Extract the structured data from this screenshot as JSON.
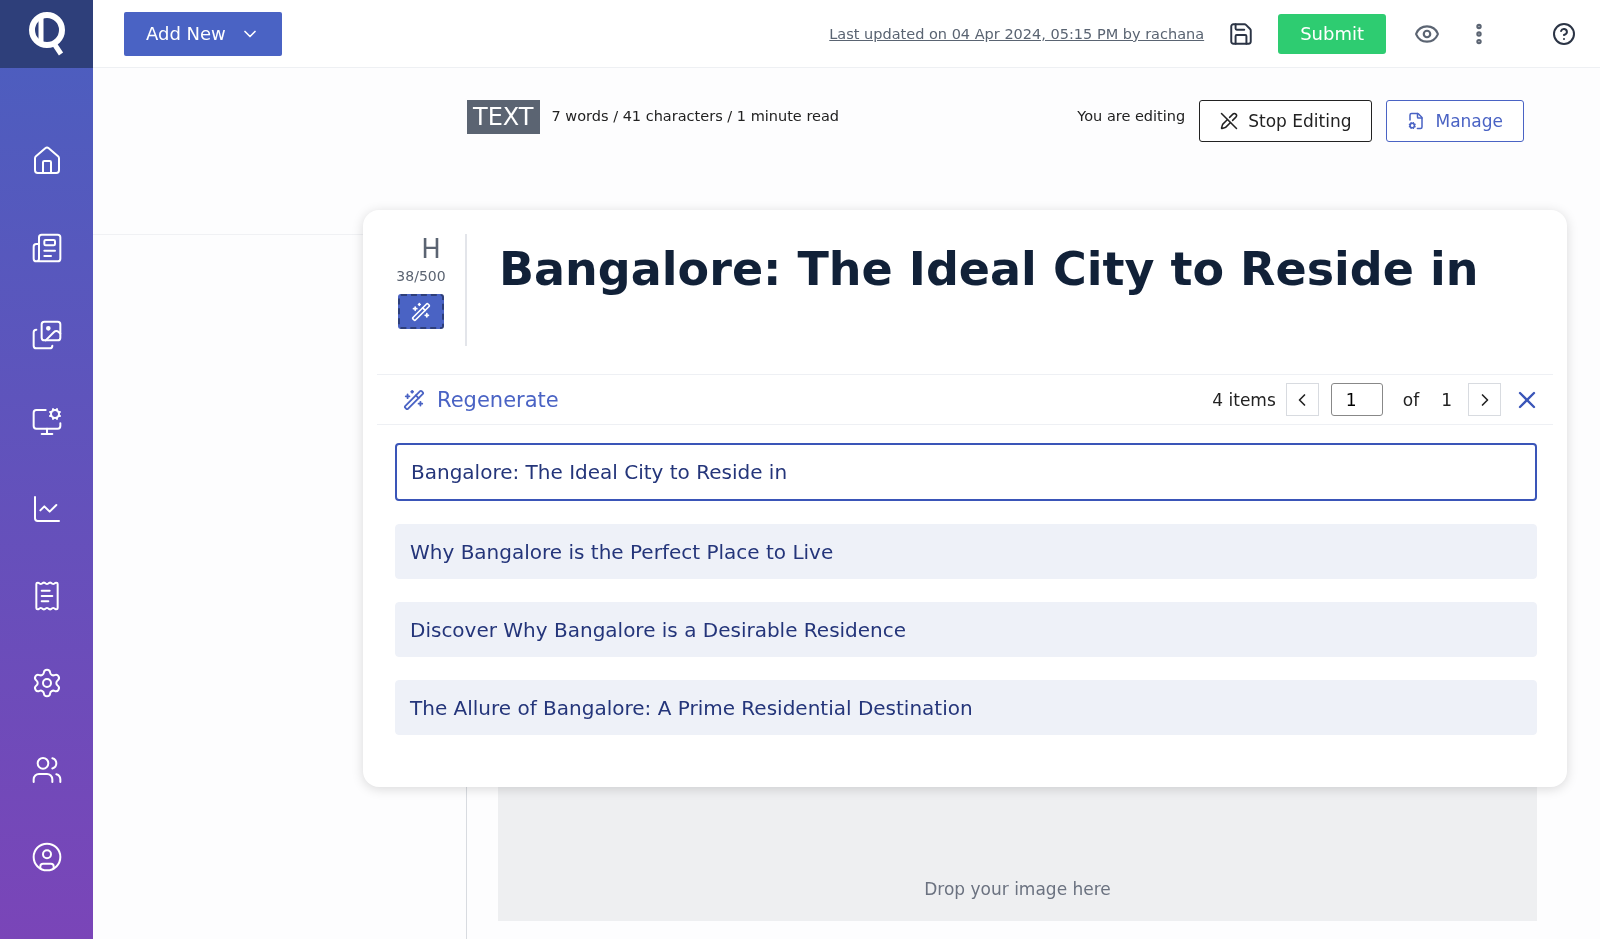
{
  "top_bar": {
    "add_button": "Add New",
    "last_updated": "Last updated on 04 Apr 2024, 05:15 PM by rachana",
    "submit": "Submit"
  },
  "info_bar": {
    "badge": "TEXT",
    "stats": "7 words / 41 characters / 1 minute read",
    "editing_label": "You are editing",
    "stop_editing": "Stop Editing",
    "manage": "Manage"
  },
  "headline_card": {
    "type_letter": "H",
    "counter": "38/500",
    "headline": "Bangalore: The Ideal City to Reside in",
    "regenerate": "Regenerate",
    "items_count": "4 items",
    "page": "1",
    "of_label": "of",
    "total_pages": "1",
    "suggestions": [
      {
        "text": "Bangalore: The Ideal City to Reside in",
        "selected": true
      },
      {
        "text": "Why Bangalore is the Perfect Place to Live",
        "selected": false
      },
      {
        "text": "Discover Why Bangalore is a Desirable Residence",
        "selected": false
      },
      {
        "text": "The Allure of Bangalore: A Prime Residential Destination",
        "selected": false
      }
    ]
  },
  "image_drop": {
    "placeholder": "Drop your image here"
  }
}
